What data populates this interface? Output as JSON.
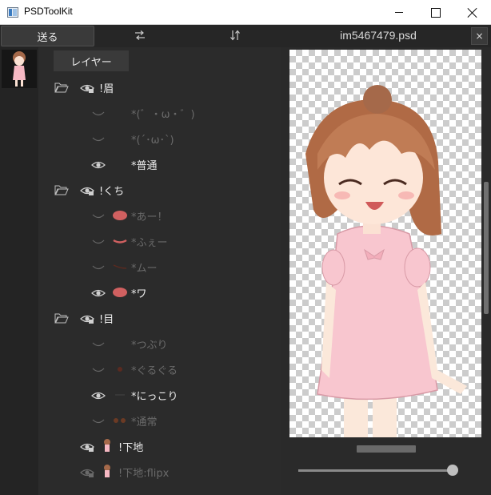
{
  "window": {
    "title": "PSDToolKit",
    "minimize_icon": "minimize-icon",
    "maximize_icon": "maximize-icon",
    "close_icon": "close-icon"
  },
  "toolbar": {
    "send_label": "送る",
    "swap_horizontal_icon": "swap-horizontal-icon",
    "swap_vertical_icon": "swap-vertical-icon",
    "file_name": "im5467479.psd",
    "close_label": "×"
  },
  "layer_panel": {
    "tab_label": "レイヤー",
    "layers": [
      {
        "label": "!眉",
        "kind": "folder",
        "visible": true,
        "locked": true
      },
      {
        "label": "*(゛・ω・゛)",
        "kind": "layer",
        "visible": false
      },
      {
        "label": "*(´･ω･`)",
        "kind": "layer",
        "visible": false
      },
      {
        "label": "*普通",
        "kind": "layer",
        "visible": true
      },
      {
        "label": "!くち",
        "kind": "folder",
        "visible": true,
        "locked": true
      },
      {
        "label": "*あー！",
        "kind": "layer",
        "visible": false
      },
      {
        "label": "*ふぇー",
        "kind": "layer",
        "visible": false
      },
      {
        "label": "*ムー",
        "kind": "layer",
        "visible": false
      },
      {
        "label": "*ワ",
        "kind": "layer",
        "visible": true
      },
      {
        "label": "!目",
        "kind": "folder",
        "visible": true,
        "locked": true
      },
      {
        "label": "*つぶり",
        "kind": "layer",
        "visible": false
      },
      {
        "label": "*ぐるぐる",
        "kind": "layer",
        "visible": false
      },
      {
        "label": "*にっこり",
        "kind": "layer",
        "visible": true
      },
      {
        "label": "*通常",
        "kind": "layer",
        "visible": false
      },
      {
        "label": "!下地",
        "kind": "layer",
        "visible": true,
        "locked": true
      },
      {
        "label": "!下地:flipx",
        "kind": "layer",
        "visible": false,
        "locked": true
      }
    ]
  },
  "preview": {
    "zoom_slider_fraction": 1.0
  },
  "colors": {
    "background": "#2a2a2a",
    "text_visible": "#ededed",
    "text_hidden": "#6a6a6a"
  }
}
